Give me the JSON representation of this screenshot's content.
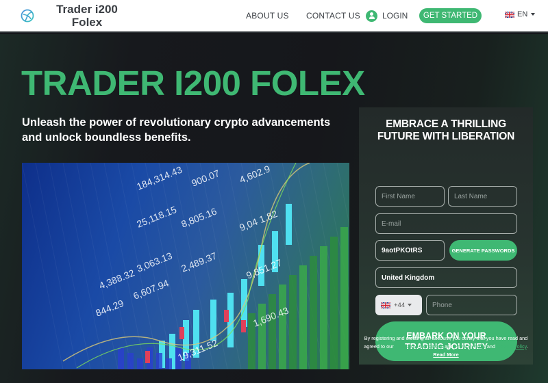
{
  "header": {
    "brand_line1": "Trader i200",
    "brand_line2": "Folex",
    "nav": {
      "about": "ABOUT US",
      "contact": "CONTACT US",
      "login": "LOGIN",
      "get_started": "GET STARTED"
    },
    "language": "EN",
    "icons": {
      "logo": "logo-swirl-icon",
      "login": "user-icon",
      "flag": "uk-flag-icon",
      "caret": "chevron-down-icon"
    }
  },
  "hero": {
    "title": "TRADER I200 FOLEX",
    "subtitle": "Unleash the power of revolutionary crypto advancements and unlock boundless benefits.",
    "image_alt": "Stock market trading chart with candlesticks and price figures"
  },
  "form": {
    "title_line1": "EMBRACE A THRILLING",
    "title_line2": "FUTURE WITH LIBERATION",
    "first_name_placeholder": "First Name",
    "last_name_placeholder": "Last Name",
    "email_placeholder": "E-mail",
    "password_value": "9aotPKOtRS",
    "generate_label": "GENERATE PASSWORDS",
    "country_value": "United Kingdom",
    "dial_code": "+44",
    "phone_placeholder": "Phone",
    "submit_line1": "EMBARK ON YOUR",
    "submit_line2": "TRADING JOURNEY"
  },
  "legal": {
    "text1": "By registering and creating an account, you certify that you have read and agreed to our ",
    "terms": "Terms and Conditions",
    "and1": " and ",
    "privacy": "Privacy Policy",
    "and2": " and ",
    "cookie": "Cookie Policy",
    "period": ". ",
    "read_more": "Read More"
  },
  "colors": {
    "accent": "#3fb873",
    "background": "#16171b",
    "header_bg": "#ffffff",
    "header_text": "#3b3f44"
  }
}
